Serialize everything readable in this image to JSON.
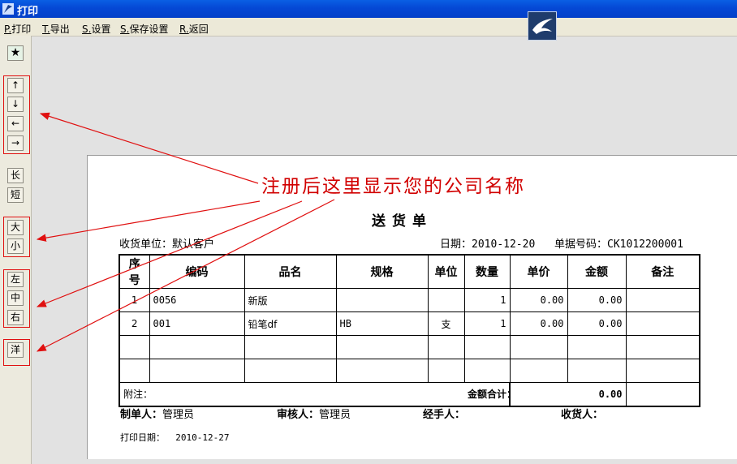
{
  "window": {
    "title": "打印"
  },
  "menu": [
    {
      "key": "P.",
      "label": "打印"
    },
    {
      "key": "T.",
      "label": "导出"
    },
    {
      "key": "S.",
      "label": "设置"
    },
    {
      "key": "S.",
      "label": "保存设置"
    },
    {
      "key": "R.",
      "label": "返回"
    }
  ],
  "toolbar": {
    "star": "★",
    "up": "↑",
    "down": "↓",
    "left": "←",
    "right": "→",
    "long": "长",
    "short": "短",
    "big": "大",
    "small": "小",
    "align_left": "左",
    "align_center": "中",
    "align_right": "右",
    "detail": "洋"
  },
  "annotation": "注册后这里显示您的公司名称",
  "document": {
    "title": "送货单",
    "receiver_label": "收货单位：",
    "receiver": "默认客户",
    "date_label": "日期：",
    "date": "2010-12-20",
    "doc_no_label": "单据号码：",
    "doc_no": "CK1012200001",
    "columns": [
      "序号",
      "编码",
      "品名",
      "规格",
      "单位",
      "数量",
      "单价",
      "金额",
      "备注"
    ],
    "rows": [
      [
        "1",
        "0056",
        "新版",
        "",
        "",
        "1",
        "0.00",
        "0.00",
        ""
      ],
      [
        "2",
        "001",
        "铅笔df",
        "HB",
        "支",
        "1",
        "0.00",
        "0.00",
        ""
      ],
      [
        "",
        "",
        "",
        "",
        "",
        "",
        "",
        "",
        ""
      ],
      [
        "",
        "",
        "",
        "",
        "",
        "",
        "",
        "",
        ""
      ]
    ],
    "remark_label": "附注：",
    "total_label": "金额合计：",
    "total": "0.00",
    "maker_label": "制单人：",
    "maker": "管理员",
    "reviewer_label": "审核人：",
    "reviewer": "管理员",
    "handler_label": "经手人：",
    "recipient_label": "收货人：",
    "print_date_label": "打印日期：",
    "print_date": "2010-12-27"
  }
}
